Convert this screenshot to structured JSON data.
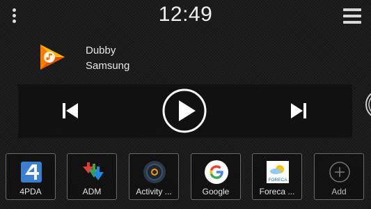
{
  "status": {
    "time": "12:49"
  },
  "now_playing": {
    "title": "Dubby",
    "artist": "Samsung"
  },
  "colors": {
    "accent_orange": "#ff8a00",
    "panel": "#0a0a0a",
    "dock_border": "#6a6a6a"
  },
  "controls": {
    "prev_icon": "skip-previous-icon",
    "play_icon": "play-icon",
    "next_icon": "skip-next-icon"
  },
  "dock": {
    "apps": [
      {
        "label": "4PDA",
        "icon": "4pda-icon"
      },
      {
        "label": "ADM",
        "icon": "adm-icon"
      },
      {
        "label": "Activity ...",
        "icon": "activity-icon"
      },
      {
        "label": "Google",
        "icon": "google-icon"
      },
      {
        "label": "Foreca ...",
        "icon": "foreca-icon",
        "icon_text": "FORECA"
      },
      {
        "label": "Add",
        "icon": "add-icon"
      }
    ]
  }
}
